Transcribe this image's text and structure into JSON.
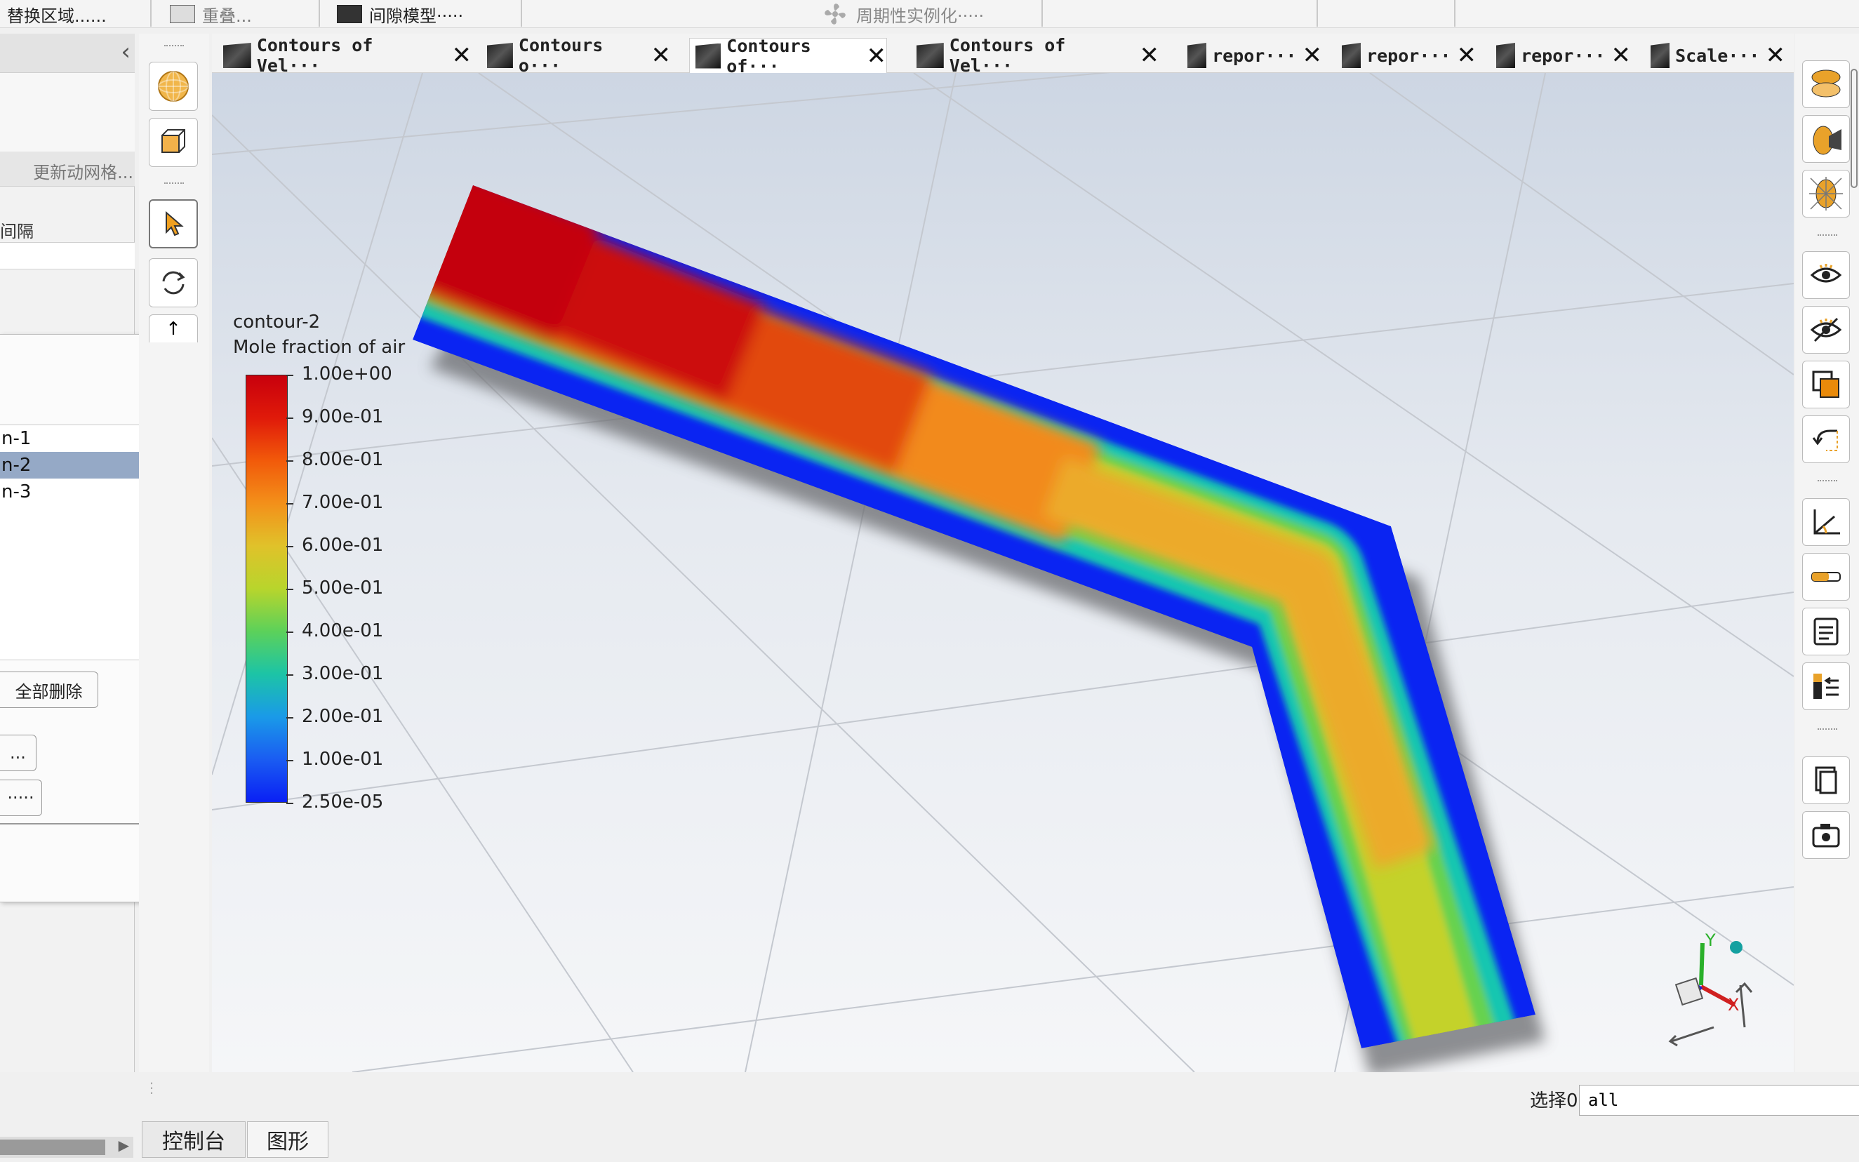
{
  "topbar": {
    "items": [
      {
        "label": "替换区域......"
      },
      {
        "label": "重叠..."
      },
      {
        "label": "间隙模型·····"
      },
      {
        "label": "周期性实例化·····"
      }
    ]
  },
  "left_panel": {
    "collapse_glyph": "‹",
    "update_mesh_label": "更新动网格...",
    "interval_label": "间隔"
  },
  "dialog": {
    "close_glyph": "✕",
    "list_items": [
      "n-1",
      "n-2",
      "n-3"
    ],
    "selected_index": 1,
    "delete_all_label": "全部删除",
    "btn_a_label": "...",
    "btn_b_label": "·····"
  },
  "tabs": [
    {
      "label": "Contours of Vel···",
      "close": "✕",
      "active": false
    },
    {
      "label": "Contours o···",
      "close": "✕",
      "active": false
    },
    {
      "label": "Contours of···",
      "close": "✕",
      "active": true
    },
    {
      "label": "Contours of Vel···",
      "close": "✕",
      "active": false
    },
    {
      "label": "repor···",
      "close": "✕",
      "active": false
    },
    {
      "label": "repor···",
      "close": "✕",
      "active": false
    },
    {
      "label": "repor···",
      "close": "✕",
      "active": false
    },
    {
      "label": "Scale···",
      "close": "✕",
      "active": false
    }
  ],
  "legend": {
    "title": "contour-2",
    "subtitle": "Mole fraction of air",
    "ticks": [
      "1.00e+00",
      "9.00e-01",
      "8.00e-01",
      "7.00e-01",
      "6.00e-01",
      "5.00e-01",
      "4.00e-01",
      "3.00e-01",
      "2.00e-01",
      "1.00e-01",
      "2.50e-05"
    ],
    "colors": [
      "#c8000c",
      "#e01a0a",
      "#f25a0a",
      "#f3901a",
      "#e0c22a",
      "#b8d52c",
      "#5cd15a",
      "#1cc4a6",
      "#1a9ae8",
      "#1a5cf2",
      "#0a20f4"
    ]
  },
  "axes_triad": {
    "x_label": "X",
    "y_label": "Y"
  },
  "bottom": {
    "select_label": "选择0",
    "select_value": "all",
    "tab_console": "控制台",
    "tab_graphics": "图形"
  }
}
